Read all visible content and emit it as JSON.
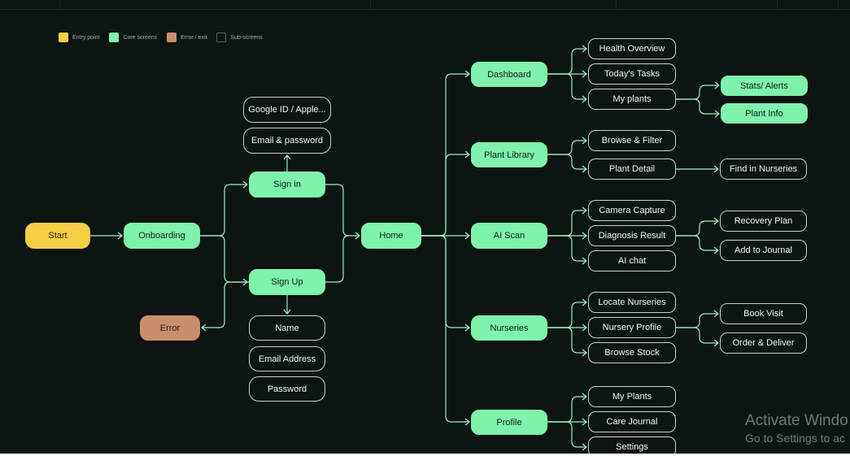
{
  "legend": [
    {
      "label": "Entry point",
      "color": "#f7cf45"
    },
    {
      "label": "Core screens",
      "color": "#7ff2ab"
    },
    {
      "label": "Error / exit",
      "color": "#c98e6b"
    },
    {
      "label": "Sub-screens",
      "color": "#0c1511"
    }
  ],
  "nodes": {
    "start": "Start",
    "onboarding": "Onboarding",
    "sign_in": "Sign in",
    "sign_up": "Sign Up",
    "error": "Error",
    "google_id": "Google ID / Apple...",
    "email_password": "Email & password",
    "name": "Name",
    "email_address": "Email Address",
    "password": "Password",
    "home": "Home",
    "dashboard": "Dashboard",
    "plant_library": "Plant Library",
    "ai_scan": "AI Scan",
    "nurseries": "Nurseries",
    "profile": "Profile",
    "health_overview": "Health Overview",
    "todays_tasks": "Today's Tasks",
    "my_plants_dash": "My plants",
    "stats_alerts": "Stats/ Alerts",
    "plant_info": "Plant Info",
    "browse_filter": "Browse & Filter",
    "plant_detail": "Plant Detail",
    "find_in_nurseries": "Find in Nurseries",
    "camera_capture": "Camera Capture",
    "diagnosis_result": "Diagnosis Result",
    "ai_chat": "AI chat",
    "recovery_plan": "Recovery Plan",
    "add_to_journal": "Add to Journal",
    "locate_nurseries": "Locate Nurseries",
    "nursery_profile": "Nursery Profile",
    "browse_stock": "Browse Stock",
    "book_visit": "Book Visit",
    "order_deliver": "Order & Deliver",
    "my_plants_profile": "My Plants",
    "care_journal": "Care Journal",
    "settings": "Settings"
  },
  "watermark": {
    "line1": "Activate Windo",
    "line2": "Go to Settings to ac"
  },
  "colors": {
    "background": "#0c1511",
    "core": "#7ff2ab",
    "entry": "#f7cf45",
    "error": "#c98e6b",
    "connector": "#9ff0c2"
  }
}
